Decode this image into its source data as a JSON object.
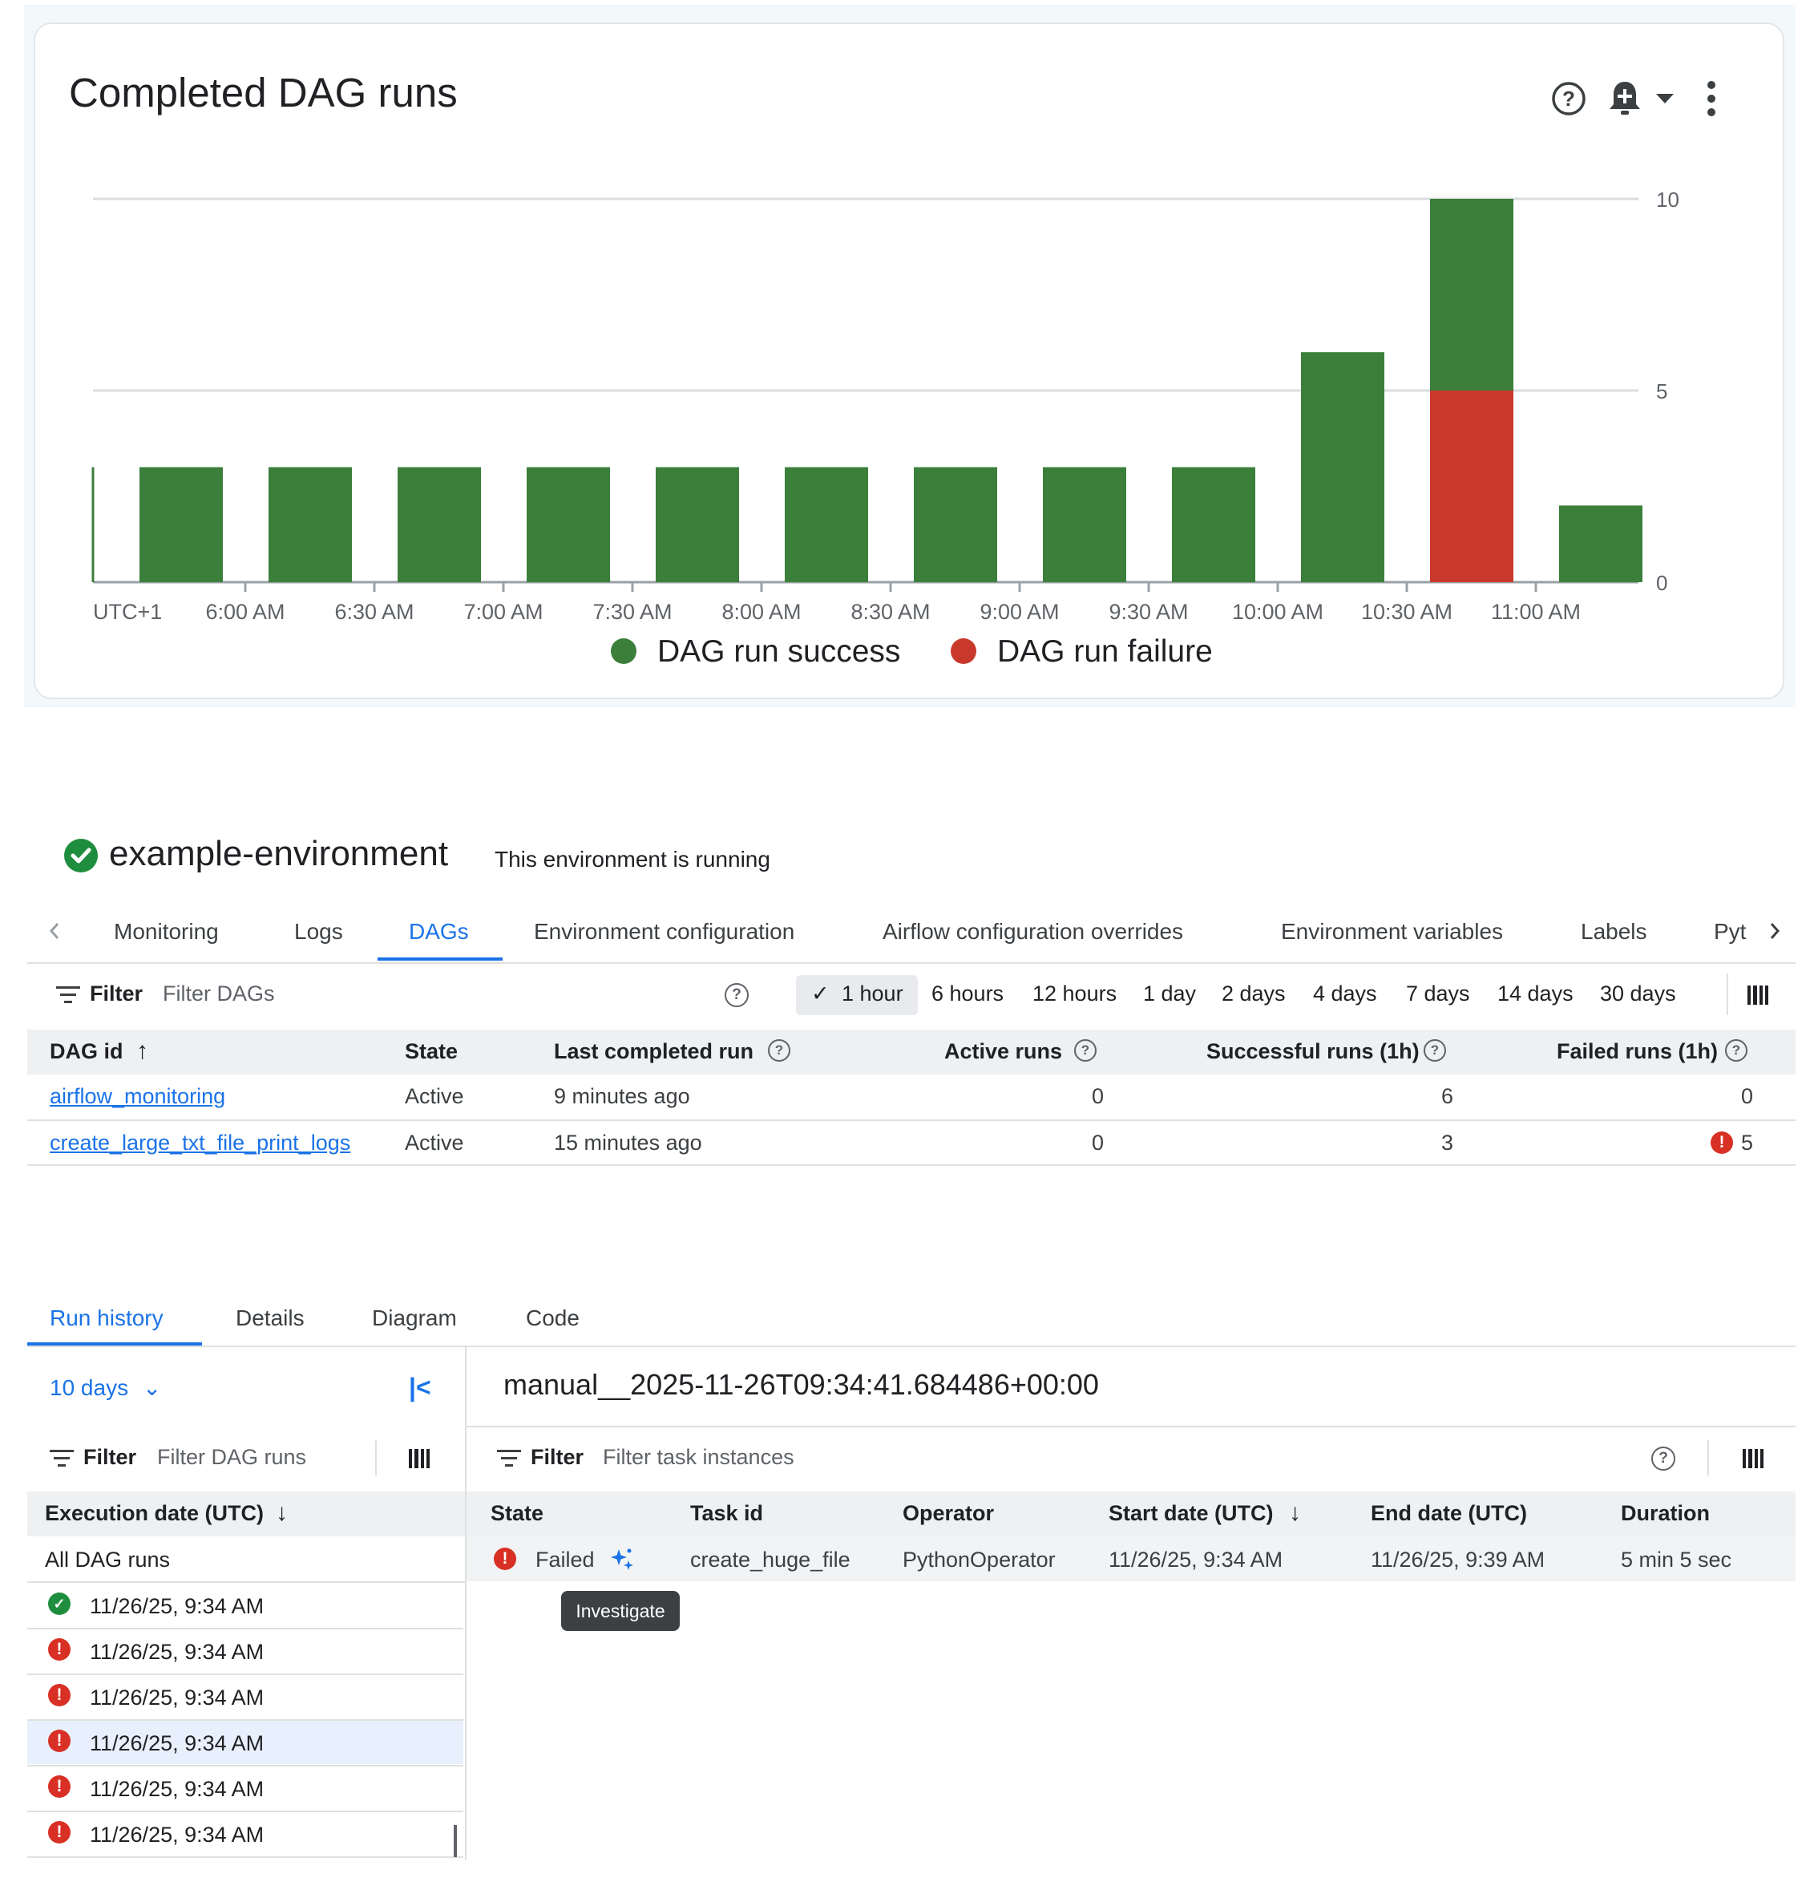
{
  "chart_card": {
    "help_icon": "help-circle-icon",
    "alert_icon": "add-alert-bell-icon",
    "dropdown_icon": "arrow-drop-down-icon",
    "menu_icon": "more-vert-icon"
  },
  "chart_data": {
    "type": "bar",
    "stacked": true,
    "title": "Completed DAG runs",
    "x_axis_prefix": "UTC+1",
    "x_tick_labels": [
      "6:00 AM",
      "6:30 AM",
      "7:00 AM",
      "7:30 AM",
      "8:00 AM",
      "8:30 AM",
      "9:00 AM",
      "9:30 AM",
      "10:00 AM",
      "10:30 AM",
      "11:00 AM"
    ],
    "y_ticks": [
      0,
      5,
      10
    ],
    "ylim": [
      0,
      10
    ],
    "grid": true,
    "legend_position": "bottom",
    "series": [
      {
        "name": "DAG run success",
        "color": "#3b7f3b",
        "values": [
          3,
          3,
          3,
          3,
          3,
          3,
          3,
          3,
          3,
          6,
          5,
          2
        ]
      },
      {
        "name": "DAG run failure",
        "color": "#c9392b",
        "values": [
          0,
          0,
          0,
          0,
          0,
          0,
          0,
          0,
          0,
          0,
          5,
          0
        ]
      }
    ]
  },
  "environment": {
    "status_icon": "check-circle-icon",
    "name": "example-environment",
    "status_text": "This environment is running"
  },
  "tabs": {
    "prev_icon": "chevron-left-icon",
    "next_icon": "chevron-right-icon",
    "items": [
      "Monitoring",
      "Logs",
      "DAGs",
      "Environment configuration",
      "Airflow configuration overrides",
      "Environment variables",
      "Labels",
      "Pyt"
    ],
    "active": "DAGs"
  },
  "dag_filter": {
    "label": "Filter",
    "placeholder": "Filter DAGs",
    "help": "?",
    "columns_icon": "view-column-icon"
  },
  "time_ranges": {
    "active_check": "✓",
    "items": [
      "1 hour",
      "6 hours",
      "12 hours",
      "1 day",
      "2 days",
      "4 days",
      "7 days",
      "14 days",
      "30 days"
    ],
    "active": "1 hour"
  },
  "dag_table": {
    "headers": [
      "DAG id",
      "State",
      "Last completed run",
      "Active runs",
      "Successful runs (1h)",
      "Failed runs (1h)"
    ],
    "sort_icon": "↑",
    "rows": [
      {
        "dag_id": "airflow_monitoring",
        "state": "Active",
        "last_run": "9 minutes ago",
        "active": "0",
        "success": "6",
        "failed": "0",
        "failed_icon": ""
      },
      {
        "dag_id": "create_large_txt_file_print_logs",
        "state": "Active",
        "last_run": "15 minutes ago",
        "active": "0",
        "success": "3",
        "failed": "5",
        "failed_icon": "!"
      }
    ]
  },
  "detail_tabs": {
    "items": [
      "Run history",
      "Details",
      "Diagram",
      "Code"
    ],
    "active": "Run history"
  },
  "run_history": {
    "range": "10 days",
    "range_icon": "⌄",
    "collapse_icon": "|<",
    "filter_label": "Filter",
    "filter_placeholder": "Filter DAG runs",
    "header": "Execution date (UTC)",
    "sort_icon": "↓",
    "all_runs": "All DAG runs",
    "runs": [
      {
        "status": "success",
        "date": "11/26/25, 9:34 AM"
      },
      {
        "status": "failed",
        "date": "11/26/25, 9:34 AM"
      },
      {
        "status": "failed",
        "date": "11/26/25, 9:34 AM"
      },
      {
        "status": "failed",
        "date": "11/26/25, 9:34 AM",
        "selected": true
      },
      {
        "status": "failed",
        "date": "11/26/25, 9:34 AM"
      },
      {
        "status": "failed",
        "date": "11/26/25, 9:34 AM"
      }
    ]
  },
  "run_detail": {
    "run_id": "manual__2025-11-26T09:34:41.684486+00:00",
    "filter_label": "Filter",
    "filter_placeholder": "Filter task instances",
    "headers": [
      "State",
      "Task id",
      "Operator",
      "Start date (UTC)",
      "End date (UTC)",
      "Duration"
    ],
    "sort_icon": "↓",
    "task": {
      "state": "Failed",
      "investigate_icon": "sparkle-investigate-icon",
      "task_id": "create_huge_file",
      "operator": "PythonOperator",
      "start": "11/26/25, 9:34 AM",
      "end": "11/26/25, 9:39 AM",
      "duration": "5 min 5 sec"
    },
    "tooltip": "Investigate"
  }
}
